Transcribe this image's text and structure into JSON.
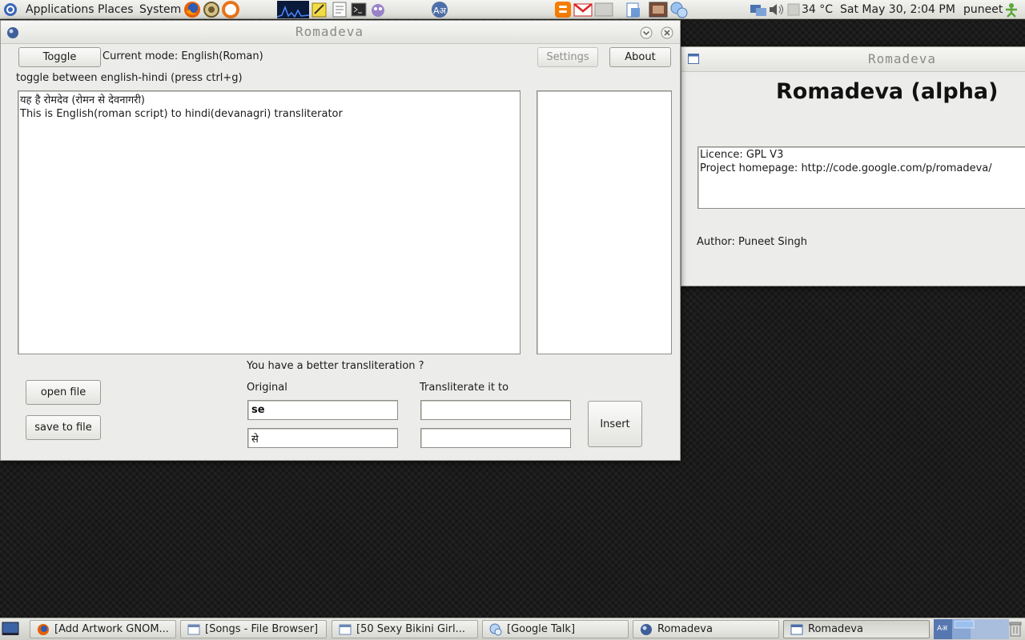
{
  "top_panel": {
    "menus": [
      "Applications",
      "Places",
      "System"
    ],
    "temperature": "34 °C",
    "clock": "Sat May 30,  2:04 PM",
    "user": "puneet"
  },
  "main_window": {
    "title": "Romadeva",
    "toggle_label": "Toggle",
    "mode_text": "Current mode: English(Roman)",
    "settings_label": "Settings",
    "about_label": "About",
    "hint": "toggle between english-hindi (press ctrl+g)",
    "editor_lines": [
      "यह है रोमदेव (रोमन से देवनागरी)",
      "This is English(roman script) to hindi(devanagri) transliterator"
    ],
    "open_file_label": "open file",
    "save_file_label": "save to file",
    "better_prompt": "You have a better transliteration ?",
    "original_label": "Original",
    "transliterate_label": "Transliterate it to",
    "original_value": "se",
    "original_hindi_value": "से",
    "translit_value": "",
    "translit_value2": "",
    "insert_label": "Insert"
  },
  "about_window": {
    "title": "Romadeva",
    "heading": "Romadeva (alpha)",
    "licence": "Licence: GPL V3",
    "homepage": "Project homepage: http://code.google.com/p/romadeva/",
    "author": "Author: Puneet Singh"
  },
  "taskbar": {
    "tasks": [
      "[Add Artwork GNOM...",
      "[Songs - File Browser]",
      "[50 Sexy  Bikini Girl...",
      "[Google Talk]",
      "Romadeva",
      "Romadeva"
    ]
  },
  "colors": {
    "desktop": "#1b1b1b",
    "panel": "#e4e4df",
    "window_bg": "#ececea",
    "title_text": "#8a8a86"
  }
}
